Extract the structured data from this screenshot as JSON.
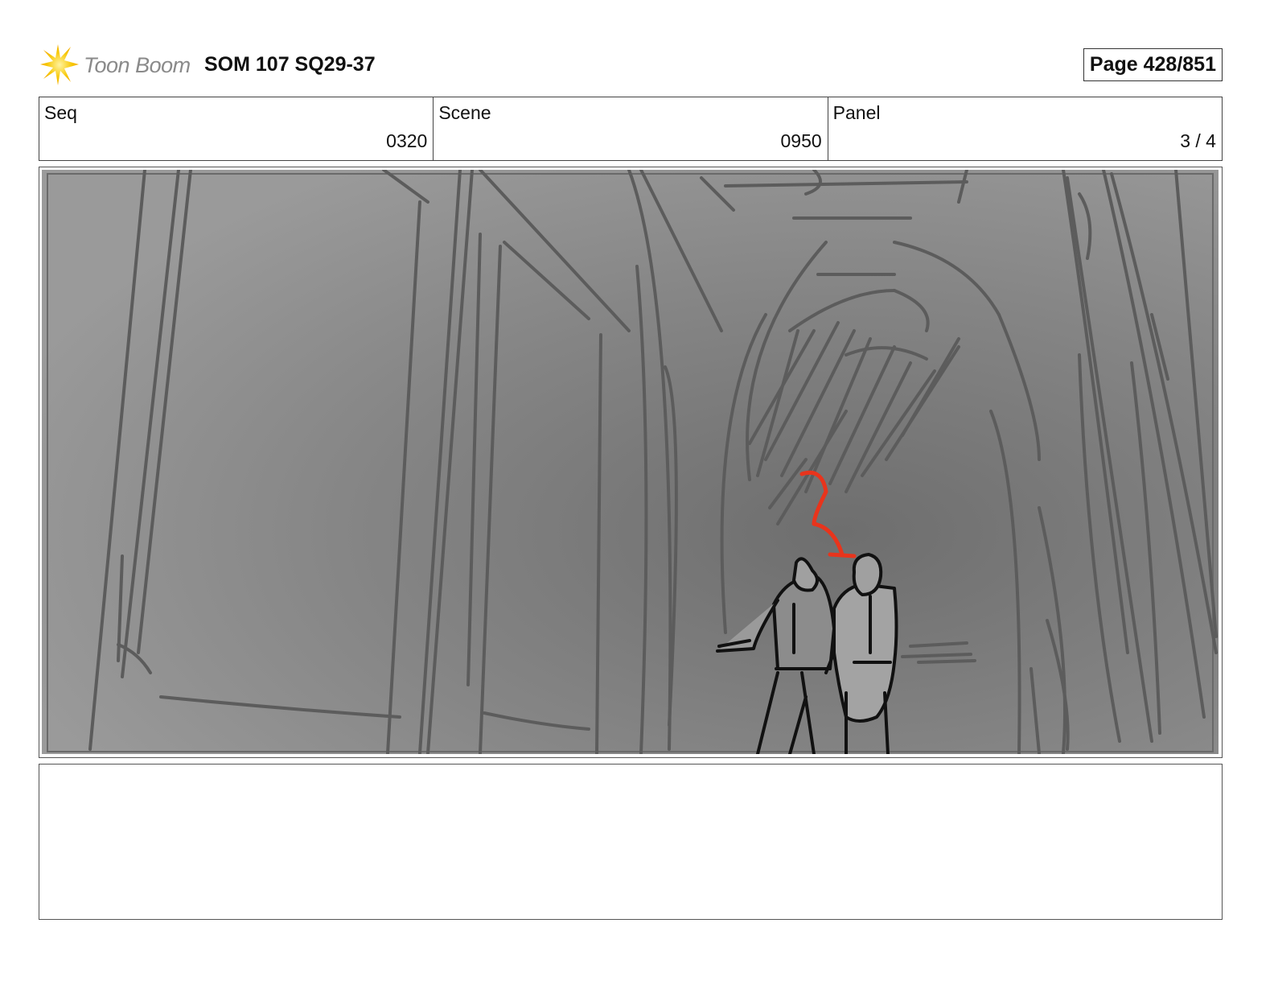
{
  "header": {
    "logo_text": "Toon Boom",
    "logo_icon": "toon-boom-star-icon",
    "title": "SOM 107 SQ29-37",
    "page": "Page 428/851"
  },
  "info": {
    "seq_label": "Seq",
    "seq_value": "0320",
    "scene_label": "Scene",
    "scene_value": "0950",
    "panel_label": "Panel",
    "panel_value": "3 / 4"
  },
  "notes": {
    "text": ""
  },
  "colors": {
    "accent_yellow": "#f5b800",
    "sketch_line": "#5f5f5f",
    "annotation_red": "#e8341c",
    "figure_ink": "#111111"
  }
}
